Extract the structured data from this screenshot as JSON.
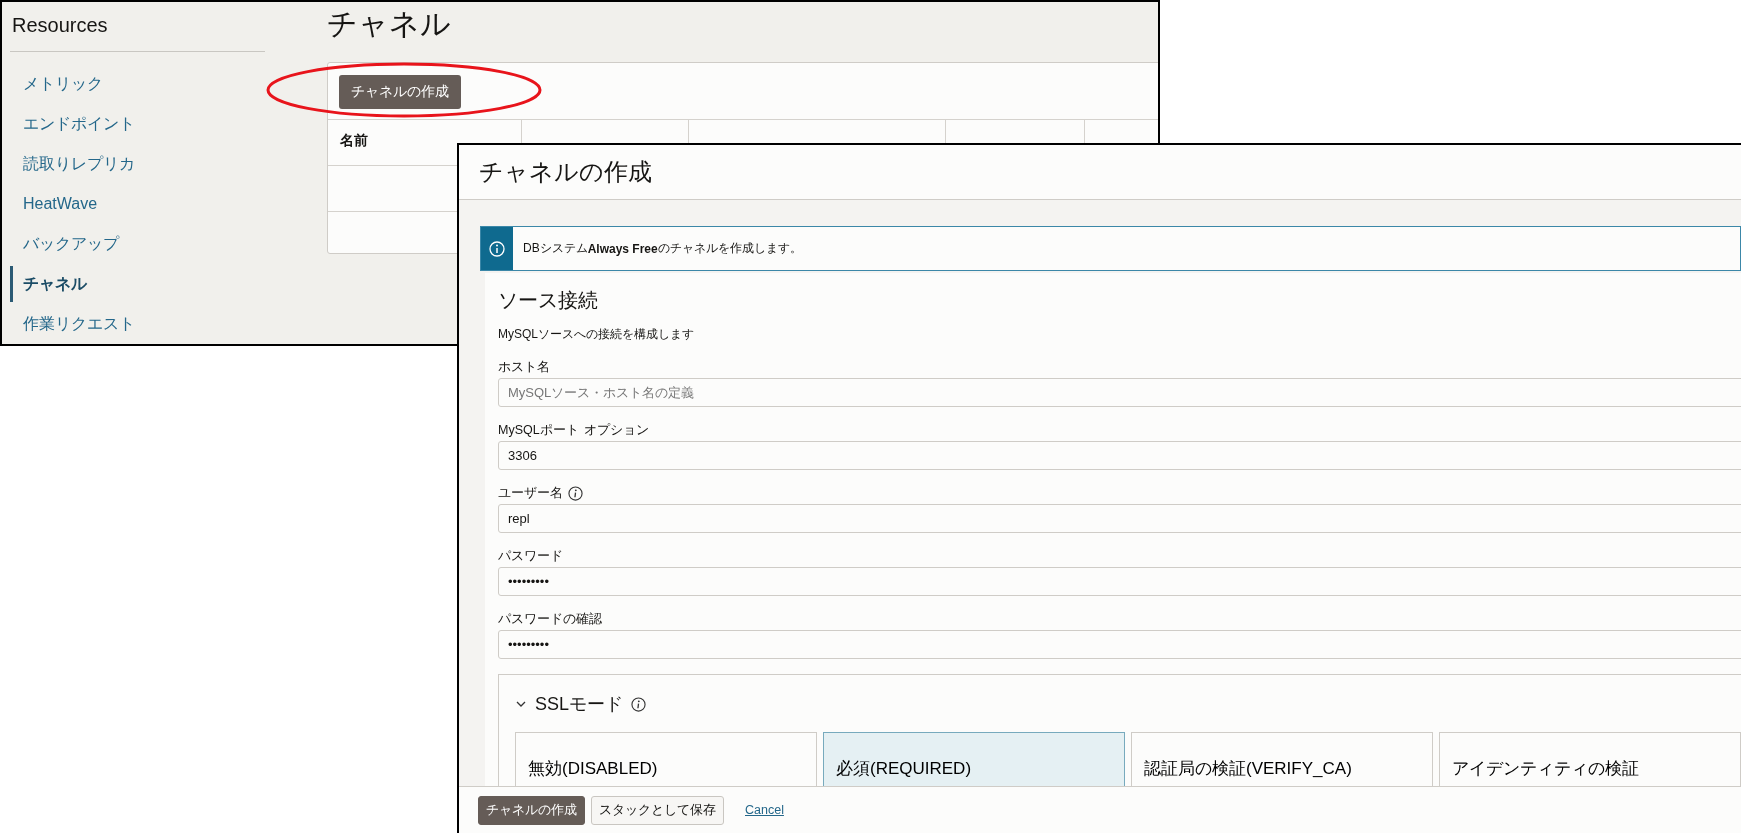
{
  "back_window": {
    "sidebar": {
      "title": "Resources",
      "items": [
        {
          "label": "メトリック",
          "selected": false
        },
        {
          "label": "エンドポイント",
          "selected": false
        },
        {
          "label": "読取りレプリカ",
          "selected": false
        },
        {
          "label": "HeatWave",
          "selected": false
        },
        {
          "label": "バックアップ",
          "selected": false
        },
        {
          "label": "チャネル",
          "selected": true
        },
        {
          "label": "作業リクエスト",
          "selected": false
        }
      ]
    },
    "page_title": "チャネル",
    "create_button": "チャネルの作成",
    "table": {
      "columns": [
        "名前"
      ]
    }
  },
  "dialog": {
    "title": "チャネルの作成",
    "banner": "DBシステム**Always Free**のチャネルを作成します。",
    "section": {
      "title": "ソース接続",
      "description": "MySQLソースへの接続を構成します",
      "fields": [
        {
          "label": "ホスト名",
          "info": false,
          "placeholder": "MySQLソース・ホスト名の定義"
        },
        {
          "label": "MySQLポート",
          "optional": "オプション",
          "info": false,
          "value": "3306"
        },
        {
          "label": "ユーザー名",
          "info": true,
          "value": "repl"
        },
        {
          "label": "パスワード",
          "info": false,
          "value": "•••••••••"
        },
        {
          "label": "パスワードの確認",
          "info": false,
          "value": "•••••••••"
        }
      ]
    },
    "ssl": {
      "title": "SSLモード",
      "expanded": true,
      "info": true,
      "options": [
        {
          "label": "無効(DISABLED)",
          "selected": false
        },
        {
          "label": "必須(REQUIRED)",
          "selected": true
        },
        {
          "label": "認証局の検証(VERIFY_CA)",
          "selected": false
        },
        {
          "label": "アイデンティティの検証",
          "selected": false
        }
      ]
    },
    "footer": {
      "buttons": [
        {
          "label": "チャネルの作成",
          "kind": "primary"
        },
        {
          "label": "スタックとして保存",
          "kind": "secondary"
        },
        {
          "label": "Cancel",
          "kind": "link"
        }
      ]
    }
  }
}
